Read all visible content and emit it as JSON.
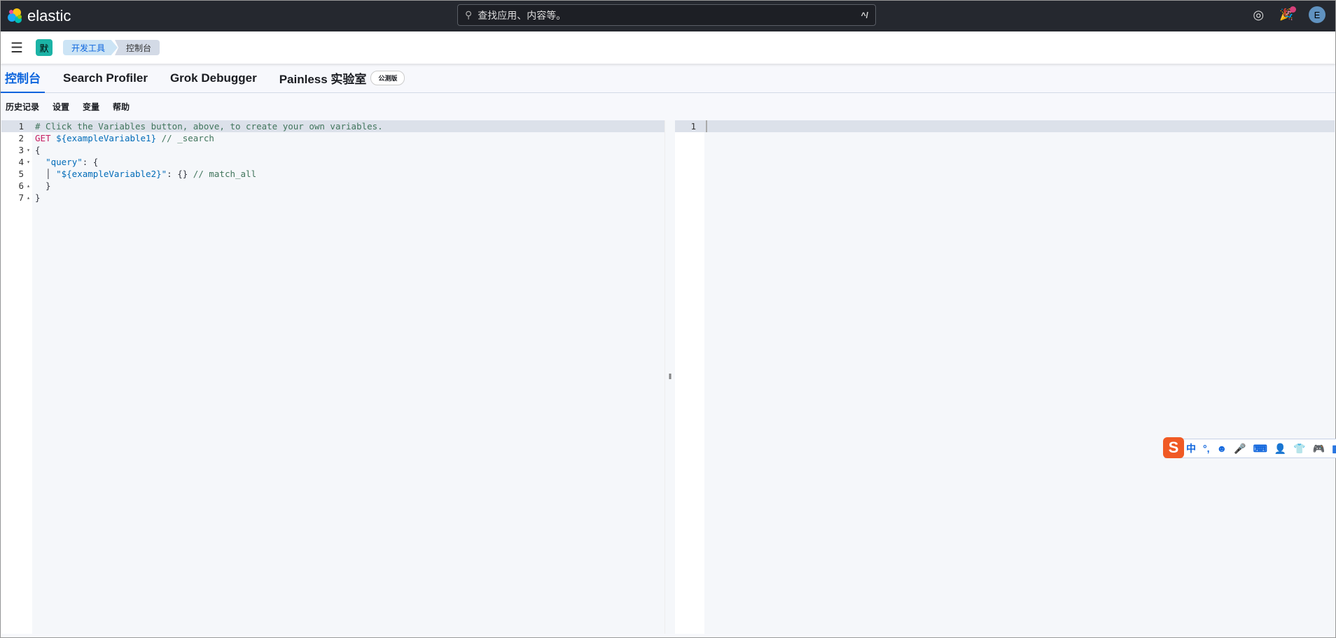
{
  "header": {
    "brand": "elastic",
    "search_placeholder": "查找应用、内容等。",
    "search_shortcut": "^/",
    "avatar_initial": "E"
  },
  "breadcrumbs": {
    "space_initial": "默",
    "items": [
      "开发工具",
      "控制台"
    ]
  },
  "tabs": [
    {
      "label": "控制台",
      "active": true
    },
    {
      "label": "Search Profiler"
    },
    {
      "label": "Grok Debugger"
    },
    {
      "label": "Painless 实验室",
      "badge": "公测版"
    }
  ],
  "toolbar": {
    "history": "历史记录",
    "settings": "设置",
    "variables": "变量",
    "help": "帮助"
  },
  "editor": {
    "lines": [
      {
        "n": "1",
        "parts": [
          [
            "cm",
            "# Click the Variables button, above, to create your own variables."
          ]
        ]
      },
      {
        "n": "2",
        "parts": [
          [
            "kw",
            "GET "
          ],
          [
            "vr",
            "${exampleVariable1}"
          ],
          [
            "cm",
            " // _search"
          ]
        ]
      },
      {
        "n": "3",
        "fold": "▾",
        "parts": [
          [
            "pu",
            "{"
          ]
        ]
      },
      {
        "n": "4",
        "fold": "▾",
        "parts": [
          [
            "pu",
            "  "
          ],
          [
            "st",
            "\"query\""
          ],
          [
            "pu",
            ": {"
          ]
        ]
      },
      {
        "n": "5",
        "parts": [
          [
            "pu",
            "  │ "
          ],
          [
            "st",
            "\"${exampleVariable2}\""
          ],
          [
            "pu",
            ": {} "
          ],
          [
            "cm",
            "// match_all"
          ]
        ]
      },
      {
        "n": "6",
        "fold": "▴",
        "parts": [
          [
            "pu",
            "  }"
          ]
        ]
      },
      {
        "n": "7",
        "fold": "▴",
        "parts": [
          [
            "pu",
            "}"
          ]
        ]
      }
    ]
  },
  "output": {
    "line_number": "1"
  },
  "splitter": "‖",
  "ime": {
    "logo": "S",
    "items": [
      "中",
      "°,",
      "☻",
      "🎤",
      "⌨",
      "👤",
      "👕",
      "🎮",
      "▦"
    ]
  }
}
